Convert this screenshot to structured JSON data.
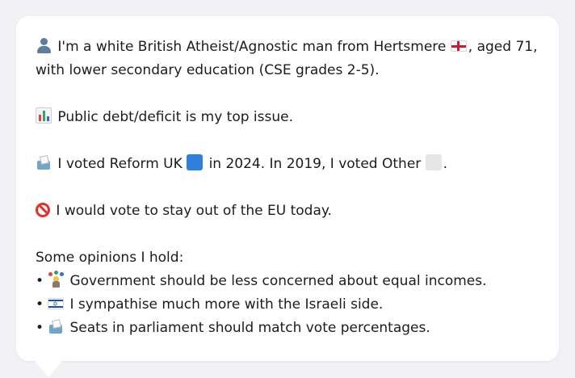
{
  "card": {
    "intro_line1": "I'm a white British Atheist/Agnostic man from Hertsmere",
    "intro_line1_end": ", aged 71,",
    "intro_line2": "with lower secondary education (CSE grades 2-5).",
    "top_issue": "Public debt/deficit is my top issue.",
    "vote_part1": "I voted Reform UK",
    "vote_part2": "in 2024. In 2019, I voted Other",
    "vote_part3": ".",
    "eu": "I would vote to stay out of the EU today.",
    "opinions_heading": "Some opinions I hold:",
    "bullet_char": "•",
    "opinions": [
      "Government should be less concerned about equal incomes.",
      "I sympathise much more with the Israeli side.",
      "Seats in parliament should match vote percentages."
    ]
  },
  "icons": {
    "person": "person-silhouette-icon",
    "england_flag": "england-flag-icon",
    "chart": "bar-chart-icon",
    "ballot": "ballot-box-icon",
    "reform_color": "blue-square-icon",
    "other_color": "white-square-icon",
    "eu": "prohibited-icon",
    "israel_flag": "israel-flag-icon"
  },
  "colors": {
    "card_background": "#ffffff",
    "page_background": "#f2f2f4",
    "text": "#1c1c1e",
    "reform_blue": "#2f7fe0",
    "prohibited_red": "#e0312b"
  }
}
